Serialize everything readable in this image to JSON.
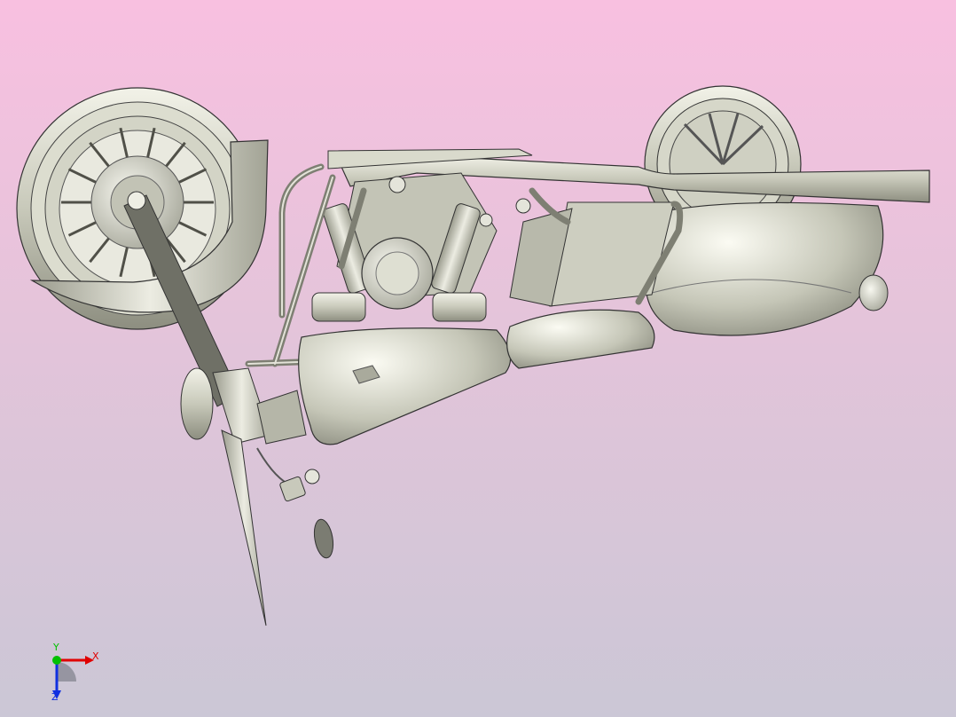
{
  "viewport": {
    "background_top": "#f8c0e0",
    "background_bottom": "#cbc7d6",
    "model_color": "#c9cabb"
  },
  "triad": {
    "x_label": "X",
    "y_label": "Y",
    "z_label": "Z",
    "x_color": "#e00000",
    "y_color": "#00c000",
    "z_color": "#1030e0"
  }
}
